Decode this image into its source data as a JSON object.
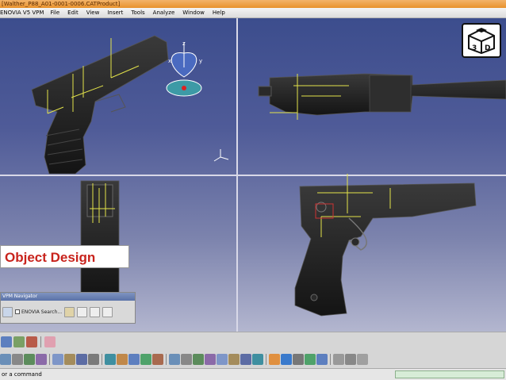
{
  "window": {
    "title": "[Walther_P88_A01-0001-0006.CATProduct]"
  },
  "menu": [
    "ENOVIA V5 VPM",
    "File",
    "Edit",
    "View",
    "Insert",
    "Tools",
    "Analyze",
    "Window",
    "Help"
  ],
  "overlay": {
    "object_design": "Object Design"
  },
  "logo": {
    "text_left": "3",
    "text_right": "D"
  },
  "compass": {
    "axis_z": "z",
    "axis_x": "x",
    "axis_y": "y"
  },
  "navigator": {
    "title": "VPM Navigator",
    "search_label": "ENOVIA Search..."
  },
  "status": {
    "command_prompt": "or a command"
  },
  "colors": {
    "viewport_top": "#3c4d8d",
    "viewport_bottom": "#b3b6cf",
    "gun_body": "#1e1e1e",
    "constraint": "#e3e34a",
    "title_bar": "#e8922c",
    "label_red": "#c8231c"
  },
  "toolbar_icons_row1": [
    "assembly-icon",
    "manipulate-icon",
    "constraint-icon",
    "update-icon"
  ],
  "toolbar_icons_row2": [
    "snap-icon",
    "zoom-icon",
    "pan-icon",
    "rotate-icon",
    "fit-all-icon",
    "normal-view-icon",
    "render-style-icon",
    "hide-show-icon",
    "measure-icon",
    "section-icon"
  ]
}
